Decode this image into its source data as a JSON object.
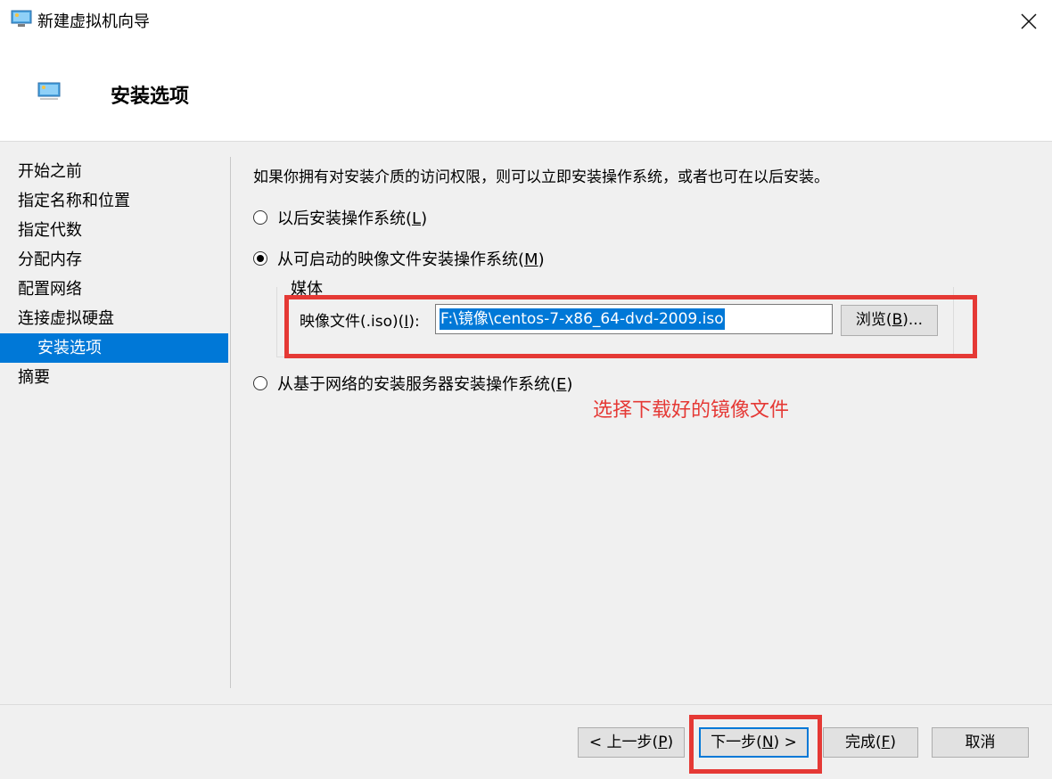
{
  "window": {
    "title": "新建虚拟机向导",
    "icon": "vm-wizard-icon",
    "close_icon": "close-icon"
  },
  "header": {
    "title": "安装选项",
    "icon": "vm-wizard-icon"
  },
  "sidebar": {
    "items": [
      {
        "label": "开始之前",
        "active": false
      },
      {
        "label": "指定名称和位置",
        "active": false
      },
      {
        "label": "指定代数",
        "active": false
      },
      {
        "label": "分配内存",
        "active": false
      },
      {
        "label": "配置网络",
        "active": false
      },
      {
        "label": "连接虚拟硬盘",
        "active": false
      },
      {
        "label": "安装选项",
        "active": true
      },
      {
        "label": "摘要",
        "active": false
      }
    ]
  },
  "main": {
    "intro": "如果你拥有对安装介质的访问权限，则可以立即安装操作系统，或者也可在以后安装。",
    "option_later": {
      "label": "以后安装操作系统(",
      "accel": "L",
      "suffix": ")",
      "checked": false
    },
    "option_image": {
      "label": "从可启动的映像文件安装操作系统(",
      "accel": "M",
      "suffix": ")",
      "checked": true
    },
    "media": {
      "legend": "媒体",
      "iso_label": "映像文件(.iso)(",
      "iso_accel": "I",
      "iso_suffix": "):",
      "iso_value": "F:\\镜像\\centos-7-x86_64-dvd-2009.iso",
      "browse": {
        "label": "浏览(",
        "accel": "B",
        "suffix": ")..."
      }
    },
    "option_network": {
      "label": "从基于网络的安装服务器安装操作系统(",
      "accel": "E",
      "suffix": ")",
      "checked": false
    },
    "annotation": "选择下载好的镜像文件"
  },
  "footer": {
    "prev": {
      "prefix": "< 上一步(",
      "accel": "P",
      "suffix": ")"
    },
    "next": {
      "prefix": "下一步(",
      "accel": "N",
      "suffix": ") >"
    },
    "finish": {
      "prefix": "完成(",
      "accel": "F",
      "suffix": ")"
    },
    "cancel": {
      "label": "取消"
    }
  },
  "colors": {
    "accent": "#0078d7",
    "annotation_red": "#e53935"
  }
}
